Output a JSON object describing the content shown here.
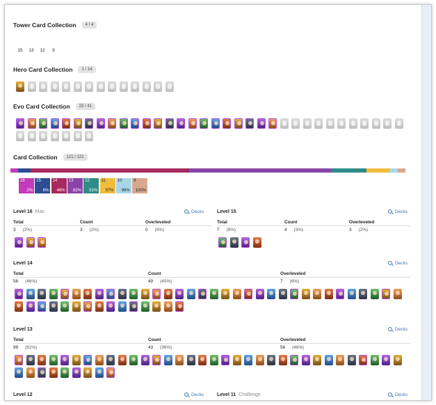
{
  "tower": {
    "title": "Tower Card Collection",
    "badge": "4 / 4",
    "levels": [
      "15",
      "13",
      "12",
      "9"
    ]
  },
  "hero": {
    "title": "Hero Card Collection",
    "badge": "1 / 14"
  },
  "evo": {
    "title": "Evo Card Collection",
    "badge": "23 / 41"
  },
  "cards": {
    "title": "Card Collection",
    "badge": "121 / 121",
    "level_boxes": [
      {
        "level": "16",
        "pct": "2%",
        "color": "#c43ab8"
      },
      {
        "level": "15",
        "pct": "6%",
        "color": "#2d4d93"
      },
      {
        "level": "14",
        "pct": "46%",
        "color": "#a8295e"
      },
      {
        "level": "13",
        "pct": "82%",
        "color": "#8a44a8"
      },
      {
        "level": "12",
        "pct": "91%",
        "color": "#2f8c87"
      },
      {
        "level": "11",
        "pct": "97%",
        "color": "#f2bd3c"
      },
      {
        "level": "10",
        "pct": "98%",
        "color": "#a8d6e9"
      },
      {
        "level": "9",
        "pct": "100%",
        "color": "#d8a98e"
      }
    ]
  },
  "labels": {
    "total": "Total",
    "count": "Count",
    "overleveled": "Overleveled",
    "decks": "Decks"
  },
  "level16": {
    "title": "Level 16",
    "sub": "Max",
    "total": "3",
    "total_pct": "(2%)",
    "count": "3",
    "count_pct": "(2%)",
    "over": "0",
    "over_pct": "(0%)"
  },
  "level15": {
    "title": "Level 15",
    "total": "7",
    "total_pct": "(6%)",
    "count": "4",
    "count_pct": "(3%)",
    "over": "3",
    "over_pct": "(2%)"
  },
  "level14": {
    "title": "Level 14",
    "total": "56",
    "total_pct": "(46%)",
    "count": "49",
    "count_pct": "(40%)",
    "over": "7",
    "over_pct": "(6%)"
  },
  "level13": {
    "title": "Level 13",
    "total": "99",
    "total_pct": "(82%)",
    "count": "43",
    "count_pct": "(36%)",
    "over": "56",
    "over_pct": "(46%)"
  },
  "level12": {
    "title": "Level 12"
  },
  "level11": {
    "title": "Level 11",
    "sub": "Challenge"
  },
  "colors": {
    "accent": "#3a76b8",
    "evo_border": "#b04ad4"
  }
}
